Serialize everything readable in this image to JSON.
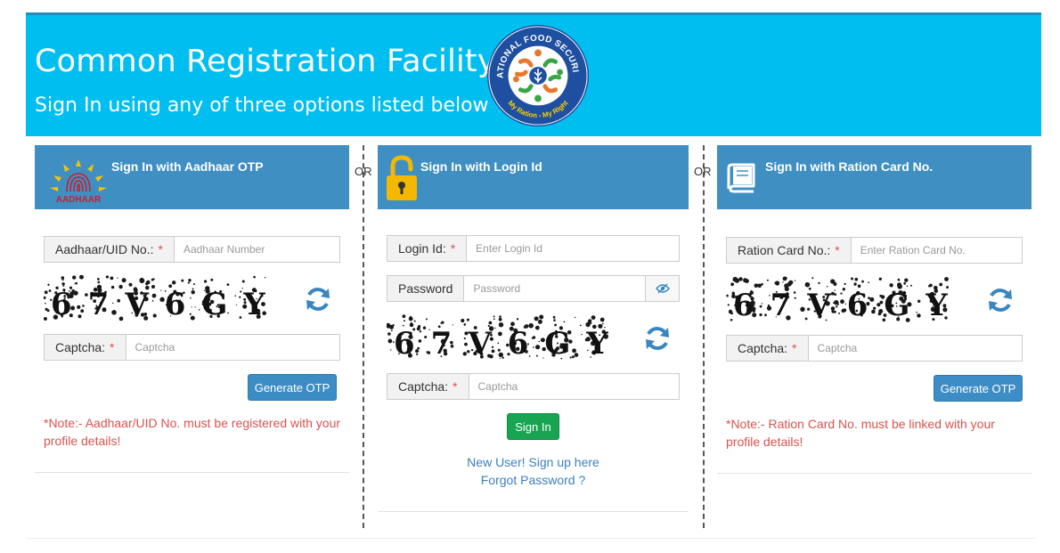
{
  "banner": {
    "title": "Common Registration Facility",
    "subtitle": "Sign In using any of three options listed below",
    "logo_text_top": "NATIONAL FOOD SECURITY",
    "logo_text_bottom": "My Ration - My Right"
  },
  "separator": "OR",
  "aadhaar": {
    "heading": "Sign In with Aadhaar OTP",
    "logo_text": "AADHAAR",
    "id_label": "Aadhaar/UID No.:",
    "id_placeholder": "Aadhaar Number",
    "captcha_text": "67V6GY",
    "captcha_label": "Captcha:",
    "captcha_placeholder": "Captcha",
    "button": "Generate OTP",
    "note": "*Note:- Aadhaar/UID No. must be registered with your profile details!"
  },
  "login": {
    "heading": "Sign In with Login Id",
    "id_label": "Login Id:",
    "id_placeholder": "Enter Login Id",
    "password_label": "Password",
    "password_placeholder": "Password",
    "captcha_text": "67V6GY",
    "captcha_label": "Captcha:",
    "captcha_placeholder": "Captcha",
    "button": "Sign In",
    "new_user": "New User! Sign up here",
    "forgot": "Forgot Password ?"
  },
  "ration": {
    "heading": "Sign In with Ration Card No.",
    "id_label": "Ration Card No.:",
    "id_placeholder": "Enter Ration Card No.",
    "captcha_text": "67V6GY",
    "captcha_label": "Captcha:",
    "captcha_placeholder": "Captcha",
    "button": "Generate OTP",
    "note": "*Note:- Ration Card No. must be linked with your profile details!"
  },
  "required_mark": "*",
  "colors": {
    "banner": "#00bff0",
    "panel_header": "#3f8fc2",
    "note": "#d9534f",
    "primary_button": "#3c8dc5",
    "success_button": "#18a551",
    "link": "#3a7fc1"
  },
  "icons": {
    "refresh": "refresh-icon",
    "lock": "lock-icon",
    "book": "book-icon",
    "eye": "eye-icon",
    "fingerprint": "aadhaar-logo"
  }
}
